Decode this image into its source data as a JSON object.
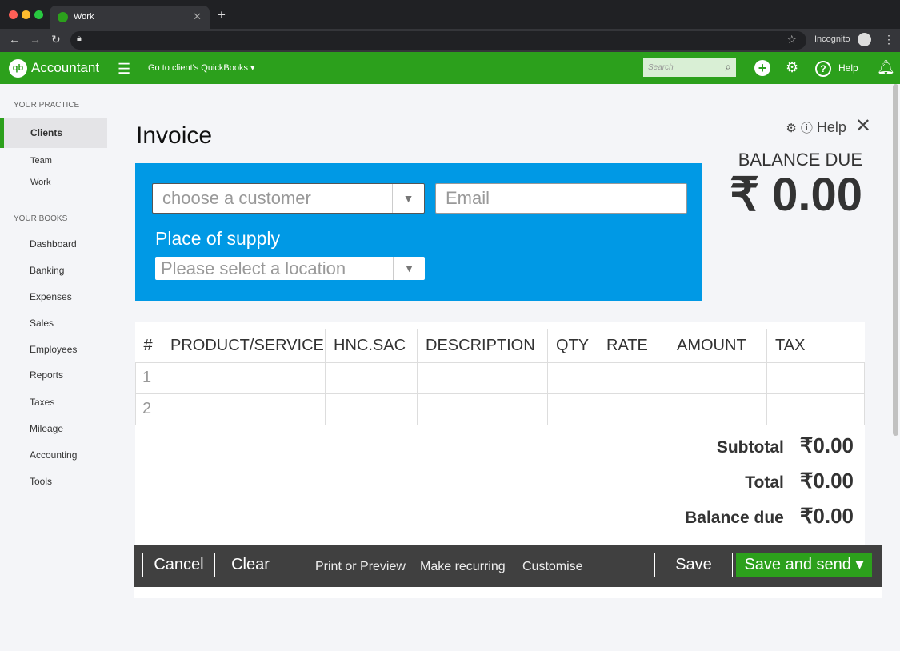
{
  "browser": {
    "tab_title": "Work",
    "mode_label": "Incognito"
  },
  "topbar": {
    "brand": "Accountant",
    "goto_label": "Go to client's QuickBooks ▾",
    "search_placeholder": "Search",
    "help_label": "Help"
  },
  "sidebar": {
    "practice_header": "YOUR PRACTICE",
    "practice_items": [
      "Clients",
      "Team",
      "Work"
    ],
    "books_header": "YOUR BOOKS",
    "books_items": [
      "Dashboard",
      "Banking",
      "Expenses",
      "Sales",
      "Employees",
      "Reports",
      "Taxes",
      "Mileage",
      "Accounting",
      "Tools"
    ]
  },
  "invoice": {
    "title": "Invoice",
    "help_label": "Help",
    "balance_label": "BALANCE DUE",
    "balance_value": "₹ 0.00",
    "customer_placeholder": "choose a customer",
    "email_placeholder": "Email",
    "place_label": "Place of supply",
    "location_placeholder": "Please select a location",
    "columns": [
      "#",
      "PRODUCT/SERVICE",
      "HNC.SAC",
      "DESCRIPTION",
      "QTY",
      "RATE",
      "AMOUNT",
      "TAX"
    ],
    "rows": [
      "1",
      "2"
    ],
    "subtotal_label": "Subtotal",
    "subtotal": "₹0.00",
    "total_label": "Total",
    "total": "₹0.00",
    "balance_due_label": "Balance due",
    "balance_due": "₹0.00"
  },
  "footer": {
    "cancel": "Cancel",
    "clear": "Clear",
    "print": "Print or Preview",
    "recurring": "Make recurring",
    "customise": "Customise",
    "save": "Save",
    "save_send": "Save and send ▾"
  }
}
